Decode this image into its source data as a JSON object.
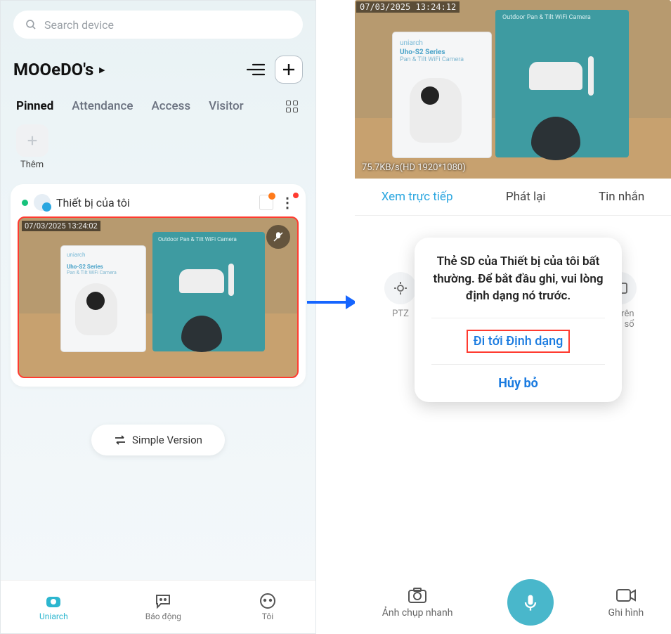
{
  "left": {
    "search_ph": "Search device",
    "account": "MOOeDO's",
    "tabs": [
      "Pinned",
      "Attendance",
      "Access",
      "Visitor"
    ],
    "add_label": "Thêm",
    "device_name": "Thiết bị của tôi",
    "preview_ts": "07/03/2025 13:24:02",
    "box1_brand": "uniarch",
    "box1_series": "Uho-S2 Series",
    "box1_desc": "Pan & Tilt WiFi Camera",
    "box2_title": "Outdoor Pan & Tilt WiFi Camera",
    "simple_btn": "Simple Version",
    "nav": [
      "Uniarch",
      "Báo động",
      "Tôi"
    ]
  },
  "right": {
    "preview_ts": "07/03/2025 13:24:12",
    "bitrate": "75.7KB/s(HD 1920*1080)",
    "box2_title": "Outdoor Pan & Tilt WiFi Camera",
    "box1_brand": "uniarch",
    "box1_series": "Uho-S2 Series",
    "box1_desc": "Pan & Tilt WiFi Camera",
    "tabs": [
      "Xem trực tiếp",
      "Phát lại",
      "Tin nhắn"
    ],
    "ctrl_ptz": "PTZ",
    "ctrl_win": "lại trên cửa sổ",
    "modal_msg": "Thẻ SD của Thiết bị của tôi bất thường. Để bắt đầu ghi, vui lòng định dạng nó trước.",
    "modal_go": "Đi tới Định dạng",
    "modal_cancel": "Hủy bỏ",
    "bot_snap": "Ảnh chụp nhanh",
    "bot_rec": "Ghi hình"
  }
}
